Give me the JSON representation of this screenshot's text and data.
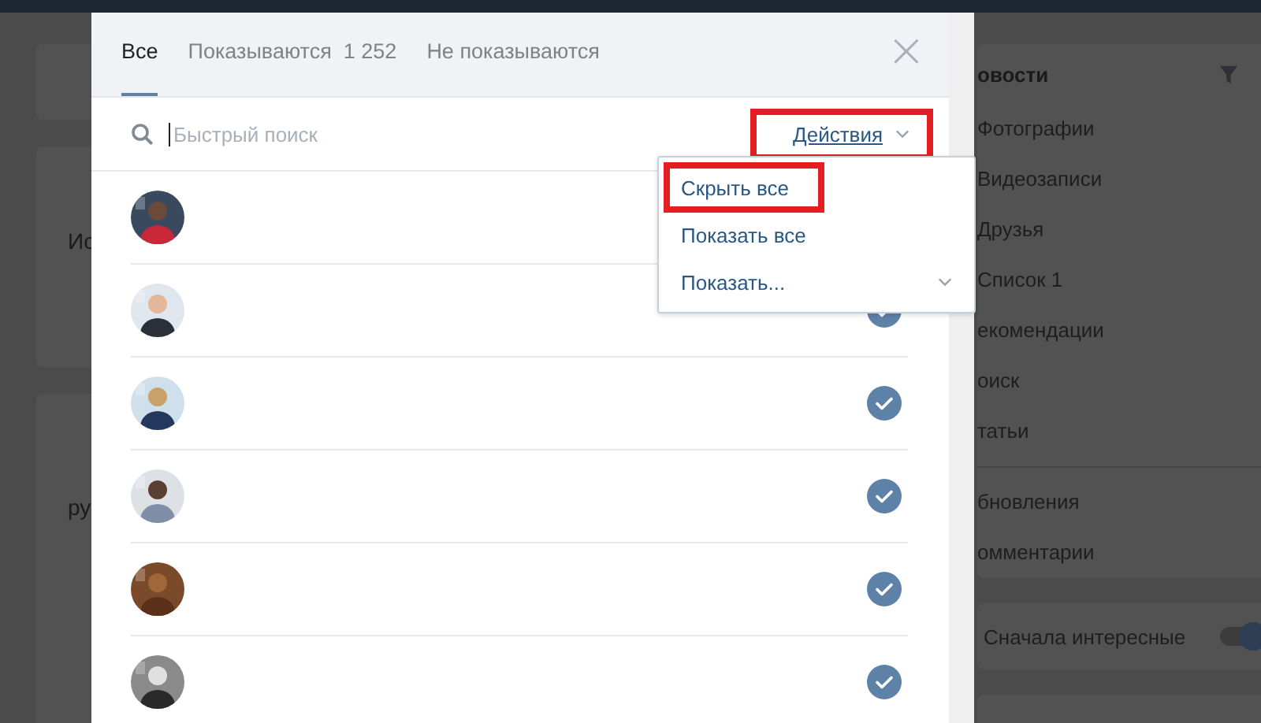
{
  "tabs": [
    {
      "label": "Все",
      "selected": true
    },
    {
      "label": "Показываются",
      "count": "1 252",
      "selected": false
    },
    {
      "label": "Не показываются",
      "selected": false
    }
  ],
  "close": "×",
  "search": {
    "placeholder": "Быстрый поиск"
  },
  "actions": {
    "label": "Действия",
    "highlighted": true
  },
  "menu": [
    {
      "label": "Скрыть все",
      "highlighted": true,
      "kind": "item"
    },
    {
      "label": "Показать все",
      "highlighted": false,
      "kind": "item"
    },
    {
      "label": "Показать...",
      "highlighted": false,
      "kind": "select"
    }
  ],
  "rows": [
    {
      "kind": "picture"
    },
    {
      "kind": "picture",
      "checked": true
    },
    {
      "kind": "picture",
      "checked": true
    },
    {
      "kind": "picture",
      "checked": true
    },
    {
      "kind": "picture",
      "checked": true
    },
    {
      "kind": "picture",
      "checked": true
    }
  ],
  "background": {
    "left_texts": [
      "Ис",
      "ру"
    ],
    "sidebar": {
      "title": "овости",
      "items": [
        "Фотографии",
        "Видеозаписи",
        "Друзья",
        "Список 1",
        "екомендации",
        "оиск",
        "татьи"
      ],
      "items_2": [
        "бновления",
        "омментарии"
      ]
    },
    "toggle": {
      "label": "Сначала интересные",
      "on": true
    }
  }
}
